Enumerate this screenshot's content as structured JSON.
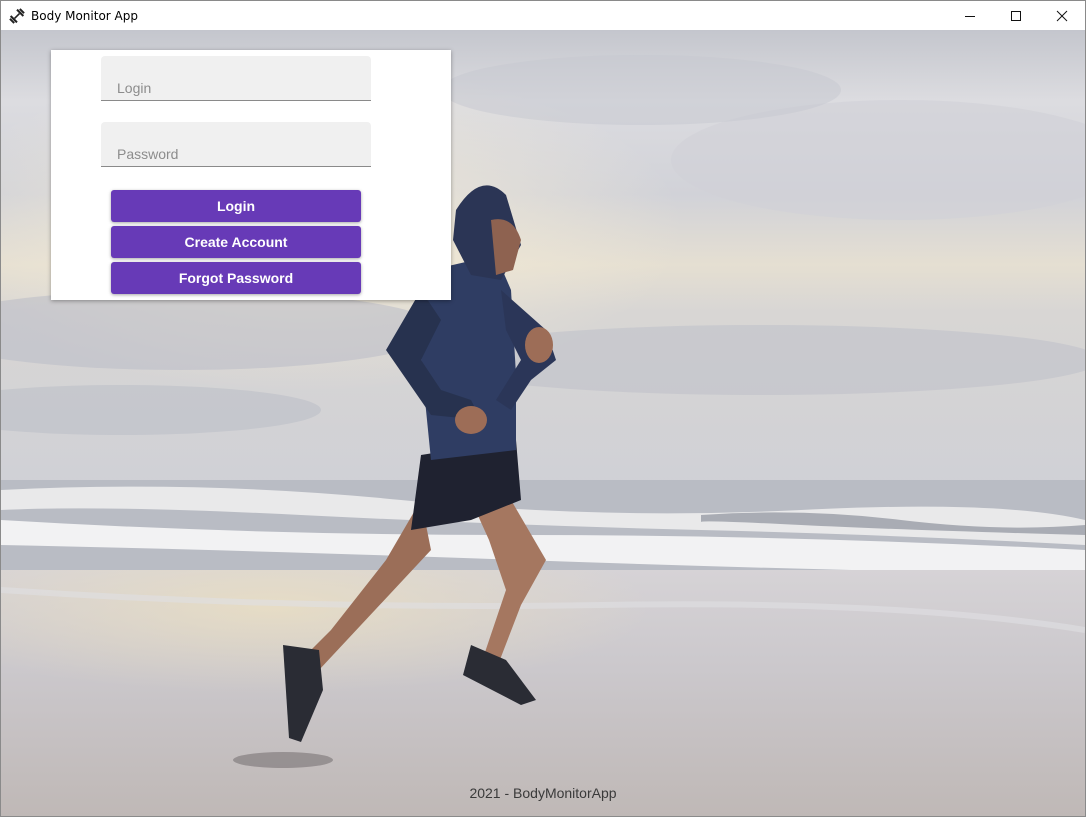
{
  "window": {
    "title": "Body Monitor App",
    "icon": "dumbbell-icon",
    "controls": [
      "minimize-icon",
      "maximize-icon",
      "close-icon"
    ]
  },
  "login_form": {
    "login_placeholder": "Login",
    "login_value": "",
    "password_placeholder": "Password",
    "password_value": "",
    "login_button": "Login",
    "create_account_button": "Create Account",
    "forgot_password_button": "Forgot Password"
  },
  "footer": {
    "text": "2021 - BodyMonitorApp"
  },
  "colors": {
    "accent": "#673ab7",
    "field_background": "#f0f0f0"
  }
}
